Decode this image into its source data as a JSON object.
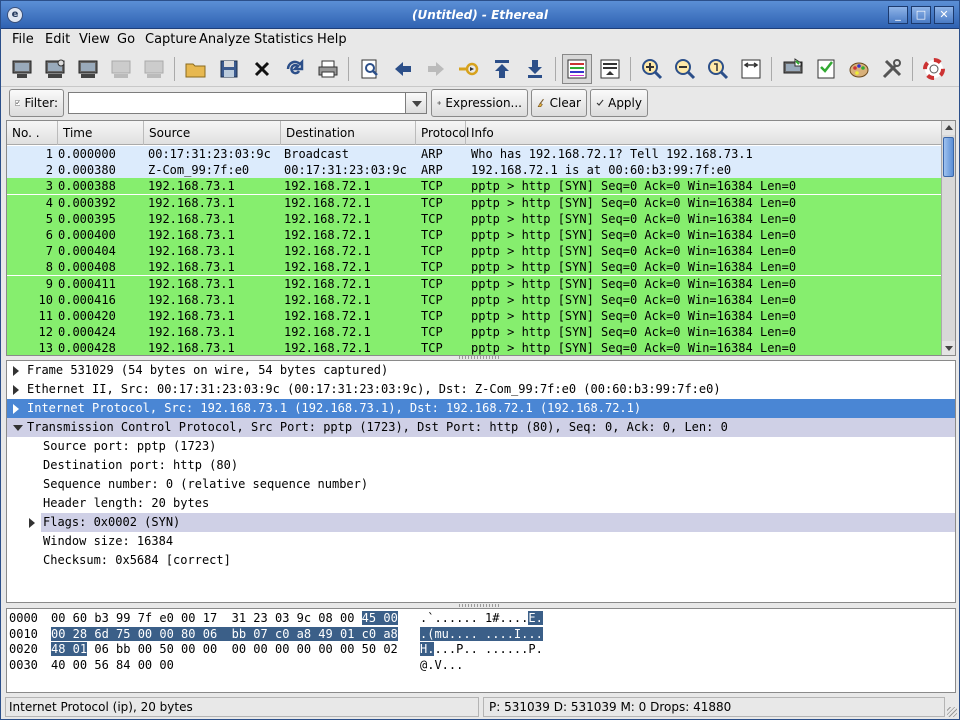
{
  "window": {
    "title": "(Untitled) - Ethereal",
    "app_icon_glyph": "e",
    "controls": {
      "minimize": "_",
      "maximize": "□",
      "close": "✕"
    }
  },
  "menu": [
    "File",
    "Edit",
    "View",
    "Go",
    "Capture",
    "Analyze",
    "Statistics",
    "Help"
  ],
  "toolbar_icons": [
    "capture-interfaces-icon",
    "capture-options-icon",
    "capture-start-icon",
    "capture-stop-icon",
    "capture-restart-icon",
    "open-file-icon",
    "save-file-icon",
    "close-file-icon",
    "reload-icon",
    "print-icon",
    "find-packet-icon",
    "go-back-icon",
    "go-forward-icon",
    "go-to-packet-icon",
    "go-first-icon",
    "go-last-icon",
    "colorize-icon",
    "auto-scroll-icon",
    "zoom-in-icon",
    "zoom-out-icon",
    "zoom-normal-icon",
    "resize-columns-icon",
    "capture-filters-icon",
    "display-filters-icon",
    "coloring-rules-icon",
    "preferences-icon",
    "help-icon"
  ],
  "filter": {
    "label": "Filter:",
    "value": "",
    "expression_label": "Expression...",
    "clear_label": "Clear",
    "apply_label": "Apply"
  },
  "packet_list": {
    "columns": [
      "No. .",
      "Time",
      "Source",
      "Destination",
      "Protocol",
      "Info"
    ],
    "rows": [
      {
        "no": "1",
        "time": "0.000000",
        "source": "00:17:31:23:03:9c",
        "destination": "Broadcast",
        "protocol": "ARP",
        "info": "Who has 192.168.72.1?  Tell 192.168.73.1",
        "color": "#dcebfc"
      },
      {
        "no": "2",
        "time": "0.000380",
        "source": "Z-Com_99:7f:e0",
        "destination": "00:17:31:23:03:9c",
        "protocol": "ARP",
        "info": "192.168.72.1 is at 00:60:b3:99:7f:e0",
        "color": "#dcebfc"
      },
      {
        "no": "3",
        "time": "0.000388",
        "source": "192.168.73.1",
        "destination": "192.168.72.1",
        "protocol": "TCP",
        "info": "pptp > http [SYN] Seq=0 Ack=0 Win=16384 Len=0",
        "color": "#86ee6e"
      },
      {
        "no": "4",
        "time": "0.000392",
        "source": "192.168.73.1",
        "destination": "192.168.72.1",
        "protocol": "TCP",
        "info": "pptp > http [SYN] Seq=0 Ack=0 Win=16384 Len=0",
        "color": "#86ee6e"
      },
      {
        "no": "5",
        "time": "0.000395",
        "source": "192.168.73.1",
        "destination": "192.168.72.1",
        "protocol": "TCP",
        "info": "pptp > http [SYN] Seq=0 Ack=0 Win=16384 Len=0",
        "color": "#86ee6e"
      },
      {
        "no": "6",
        "time": "0.000400",
        "source": "192.168.73.1",
        "destination": "192.168.72.1",
        "protocol": "TCP",
        "info": "pptp > http [SYN] Seq=0 Ack=0 Win=16384 Len=0",
        "color": "#86ee6e"
      },
      {
        "no": "7",
        "time": "0.000404",
        "source": "192.168.73.1",
        "destination": "192.168.72.1",
        "protocol": "TCP",
        "info": "pptp > http [SYN] Seq=0 Ack=0 Win=16384 Len=0",
        "color": "#86ee6e"
      },
      {
        "no": "8",
        "time": "0.000408",
        "source": "192.168.73.1",
        "destination": "192.168.72.1",
        "protocol": "TCP",
        "info": "pptp > http [SYN] Seq=0 Ack=0 Win=16384 Len=0",
        "color": "#86ee6e"
      },
      {
        "no": "9",
        "time": "0.000411",
        "source": "192.168.73.1",
        "destination": "192.168.72.1",
        "protocol": "TCP",
        "info": "pptp > http [SYN] Seq=0 Ack=0 Win=16384 Len=0",
        "color": "#86ee6e"
      },
      {
        "no": "10",
        "time": "0.000416",
        "source": "192.168.73.1",
        "destination": "192.168.72.1",
        "protocol": "TCP",
        "info": "pptp > http [SYN] Seq=0 Ack=0 Win=16384 Len=0",
        "color": "#86ee6e"
      },
      {
        "no": "11",
        "time": "0.000420",
        "source": "192.168.73.1",
        "destination": "192.168.72.1",
        "protocol": "TCP",
        "info": "pptp > http [SYN] Seq=0 Ack=0 Win=16384 Len=0",
        "color": "#86ee6e"
      },
      {
        "no": "12",
        "time": "0.000424",
        "source": "192.168.73.1",
        "destination": "192.168.72.1",
        "protocol": "TCP",
        "info": "pptp > http [SYN] Seq=0 Ack=0 Win=16384 Len=0",
        "color": "#86ee6e"
      },
      {
        "no": "13",
        "time": "0.000428",
        "source": "192.168.73.1",
        "destination": "192.168.72.1",
        "protocol": "TCP",
        "info": "pptp > http [SYN] Seq=0 Ack=0 Win=16384 Len=0",
        "color": "#86ee6e"
      }
    ]
  },
  "details": [
    {
      "text": "Frame 531029 (54 bytes on wire, 54 bytes captured)",
      "expander": "collapsed",
      "indent": 0,
      "state": "normal"
    },
    {
      "text": "Ethernet II, Src: 00:17:31:23:03:9c (00:17:31:23:03:9c), Dst: Z-Com_99:7f:e0 (00:60:b3:99:7f:e0)",
      "expander": "collapsed",
      "indent": 0,
      "state": "normal"
    },
    {
      "text": "Internet Protocol, Src: 192.168.73.1 (192.168.73.1), Dst: 192.168.72.1 (192.168.72.1)",
      "expander": "collapsed",
      "indent": 0,
      "state": "selected"
    },
    {
      "text": "Transmission Control Protocol, Src Port: pptp (1723), Dst Port: http (80), Seq: 0, Ack: 0, Len: 0",
      "expander": "expanded",
      "indent": 0,
      "state": "highlight"
    },
    {
      "text": "Source port: pptp (1723)",
      "expander": "none",
      "indent": 1,
      "state": "normal"
    },
    {
      "text": "Destination port: http (80)",
      "expander": "none",
      "indent": 1,
      "state": "normal"
    },
    {
      "text": "Sequence number: 0    (relative sequence number)",
      "expander": "none",
      "indent": 1,
      "state": "normal"
    },
    {
      "text": "Header length: 20 bytes",
      "expander": "none",
      "indent": 1,
      "state": "normal"
    },
    {
      "text": "Flags: 0x0002 (SYN)",
      "expander": "collapsed",
      "indent": 1,
      "state": "highlight"
    },
    {
      "text": "Window size: 16384",
      "expander": "none",
      "indent": 1,
      "state": "normal"
    },
    {
      "text": "Checksum: 0x5684 [correct]",
      "expander": "none",
      "indent": 1,
      "state": "normal"
    }
  ],
  "hex_dump": [
    {
      "offset": "0000",
      "hex_plain": "00 60 b3 99 7f e0 00 17  31 23 03 9c 08 00 ",
      "hex_sel": "45 00",
      "hex_after": "",
      "ascii_plain": ".`...... 1#....",
      "ascii_sel": "E.",
      "ascii_after": ""
    },
    {
      "offset": "0010",
      "hex_plain": "",
      "hex_sel": "00 28 6d 75 00 00 80 06  bb 07 c0 a8 49 01 c0 a8",
      "hex_after": "",
      "ascii_plain": "",
      "ascii_sel": ".(mu.... ....I...",
      "ascii_after": ""
    },
    {
      "offset": "0020",
      "hex_plain": "",
      "hex_sel": "48 01",
      "hex_after": " 06 bb 00 50 00 00  00 00 00 00 00 00 50 02",
      "ascii_plain": "",
      "ascii_sel": "H.",
      "ascii_after": "...P.. ......P."
    },
    {
      "offset": "0030",
      "hex_plain": "40 00 56 84 00 00",
      "hex_sel": "",
      "hex_after": "",
      "ascii_plain": "@.V...",
      "ascii_sel": "",
      "ascii_after": ""
    }
  ],
  "status": {
    "field_info": "Internet Protocol (ip), 20 bytes",
    "counts": "P: 531039 D: 531039 M: 0 Drops: 41880"
  }
}
